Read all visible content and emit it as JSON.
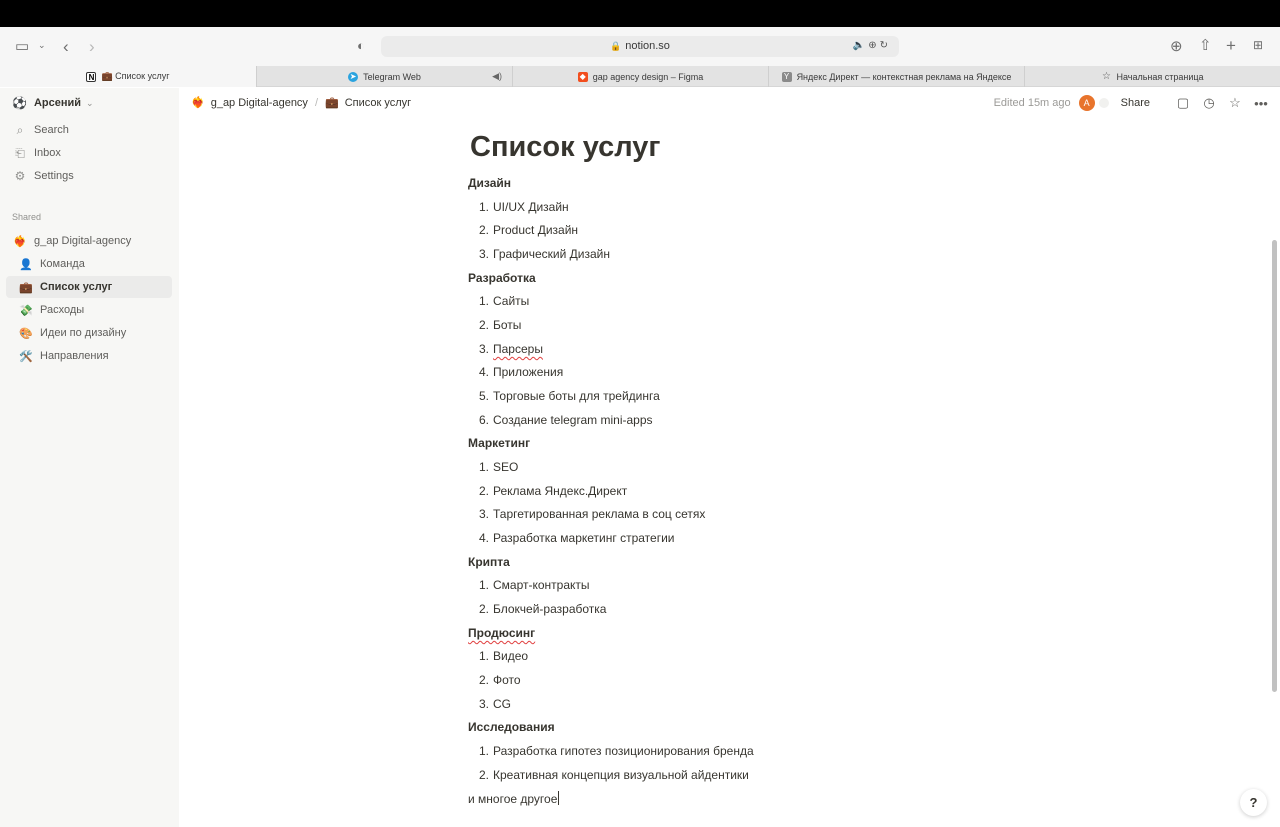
{
  "browser": {
    "url": "notion.so",
    "tabs": [
      {
        "label": "💼 Список услуг",
        "active": true
      },
      {
        "label": "Telegram Web",
        "active": false
      },
      {
        "label": "gap agency design – Figma",
        "active": false
      },
      {
        "label": "Яндекс Директ — контекстная реклама на Яндексе",
        "active": false
      },
      {
        "label": "Начальная страница",
        "active": false
      }
    ],
    "icons": {
      "sidebar_toggle": "sidebar-toggle-icon",
      "back": "back-arrow-icon",
      "forward": "forward-arrow-icon",
      "privacy": "shield-icon",
      "download": "download-icon",
      "share": "share-icon",
      "new_tab": "plus-icon",
      "tab_overview": "grid-icon"
    }
  },
  "sidebar": {
    "workspace_user": "Арсений",
    "nav": [
      {
        "label": "Search",
        "icon": "search-icon"
      },
      {
        "label": "Inbox",
        "icon": "inbox-icon"
      },
      {
        "label": "Settings",
        "icon": "gear-icon"
      }
    ],
    "section_label": "Shared",
    "pages": [
      {
        "emoji": "❤️‍🔥",
        "label": "g_ap Digital-agency"
      },
      {
        "emoji": "👤",
        "label": "Команда"
      },
      {
        "emoji": "💼",
        "label": "Список услуг"
      },
      {
        "emoji": "💸",
        "label": "Расходы"
      },
      {
        "emoji": "🎨",
        "label": "Идеи по дизайну"
      },
      {
        "emoji": "🛠️",
        "label": "Направления"
      }
    ]
  },
  "header": {
    "breadcrumb_root": "g_ap Digital-agency",
    "breadcrumb_root_emoji": "❤️‍🔥",
    "breadcrumb_separator": "/",
    "breadcrumb_current": "Список услуг",
    "breadcrumb_current_emoji": "💼",
    "edited": "Edited 15m ago",
    "avatar_initial": "A",
    "share_label": "Share"
  },
  "document": {
    "title": "Список услуг",
    "sections": [
      {
        "heading": "Дизайн",
        "items": [
          "UI/UX Дизайн",
          "Product Дизайн",
          "Графический Дизайн"
        ]
      },
      {
        "heading": "Разработка",
        "items": [
          "Сайты",
          "Боты",
          "Парсеры",
          "Приложения",
          "Торговые боты для трейдинга",
          "Создание telegram mini-apps"
        ]
      },
      {
        "heading": "Маркетинг",
        "items": [
          "SEO",
          "Реклама Яндекс.Директ",
          "Таргетированная реклама в соц сетях",
          "Разработка маркетинг стратегии"
        ]
      },
      {
        "heading": "Крипта",
        "items": [
          "Смарт-контракты",
          "Блокчей-разработка"
        ]
      },
      {
        "heading": "Продюсинг",
        "items": [
          "Видео",
          "Фото",
          "CG"
        ]
      },
      {
        "heading": "Исследования",
        "items": [
          "Разработка гипотез позиционирования бренда",
          "Креативная концепция визуальной айдентики"
        ]
      }
    ],
    "footer_text": "и многое другое"
  },
  "help_label": "?"
}
